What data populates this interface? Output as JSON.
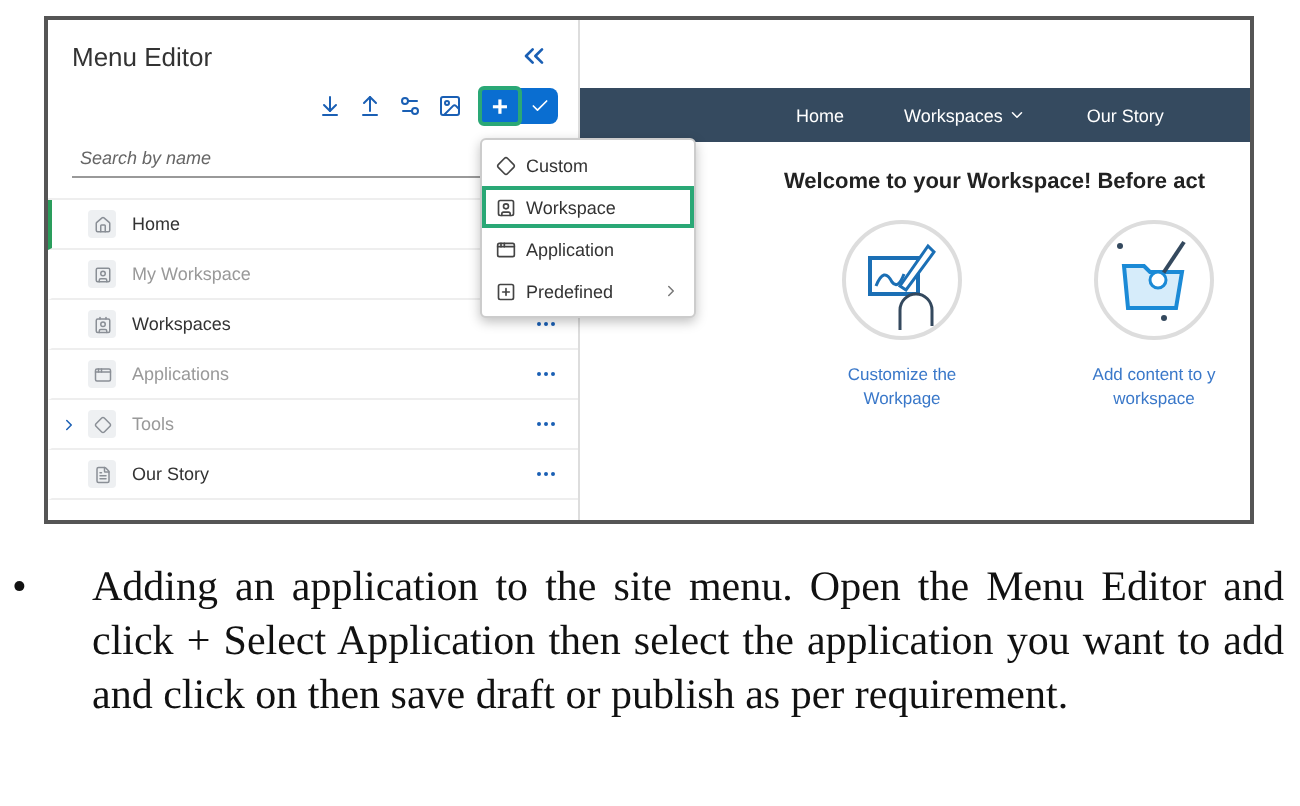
{
  "panel": {
    "title": "Menu Editor",
    "search": {
      "placeholder": "Search by name"
    },
    "add_button": {
      "label": "+",
      "highlighted": true
    },
    "items": [
      {
        "label": "Home",
        "selected": true,
        "disabled": false,
        "more": false,
        "expandable": false
      },
      {
        "label": "My Workspace",
        "selected": false,
        "disabled": true,
        "more": false,
        "expandable": false
      },
      {
        "label": "Workspaces",
        "selected": false,
        "disabled": false,
        "more": true,
        "expandable": false
      },
      {
        "label": "Applications",
        "selected": false,
        "disabled": true,
        "more": true,
        "expandable": false
      },
      {
        "label": "Tools",
        "selected": false,
        "disabled": true,
        "more": true,
        "expandable": true
      },
      {
        "label": "Our Story",
        "selected": false,
        "disabled": false,
        "more": true,
        "expandable": false
      }
    ]
  },
  "add_menu": {
    "items": [
      {
        "label": "Custom",
        "highlighted": false,
        "submenu": false
      },
      {
        "label": "Workspace",
        "highlighted": true,
        "submenu": false
      },
      {
        "label": "Application",
        "highlighted": false,
        "submenu": false
      },
      {
        "label": "Predefined",
        "highlighted": false,
        "submenu": true
      }
    ]
  },
  "nav": [
    {
      "label": "Home",
      "dropdown": false
    },
    {
      "label": "Workspaces",
      "dropdown": true
    },
    {
      "label": "Our Story",
      "dropdown": false
    }
  ],
  "heading": "Welcome to your Workspace! Before act",
  "cards": [
    {
      "lines": [
        "Customize the",
        "Workpage"
      ]
    },
    {
      "lines": [
        "Add content to y",
        "workspace"
      ]
    }
  ],
  "note": {
    "bullet": "•",
    "text": "Adding an application to the site menu. Open the Menu Editor and click + Select Application then select the application you want to add and click on then save draft or publish as per requirement."
  }
}
